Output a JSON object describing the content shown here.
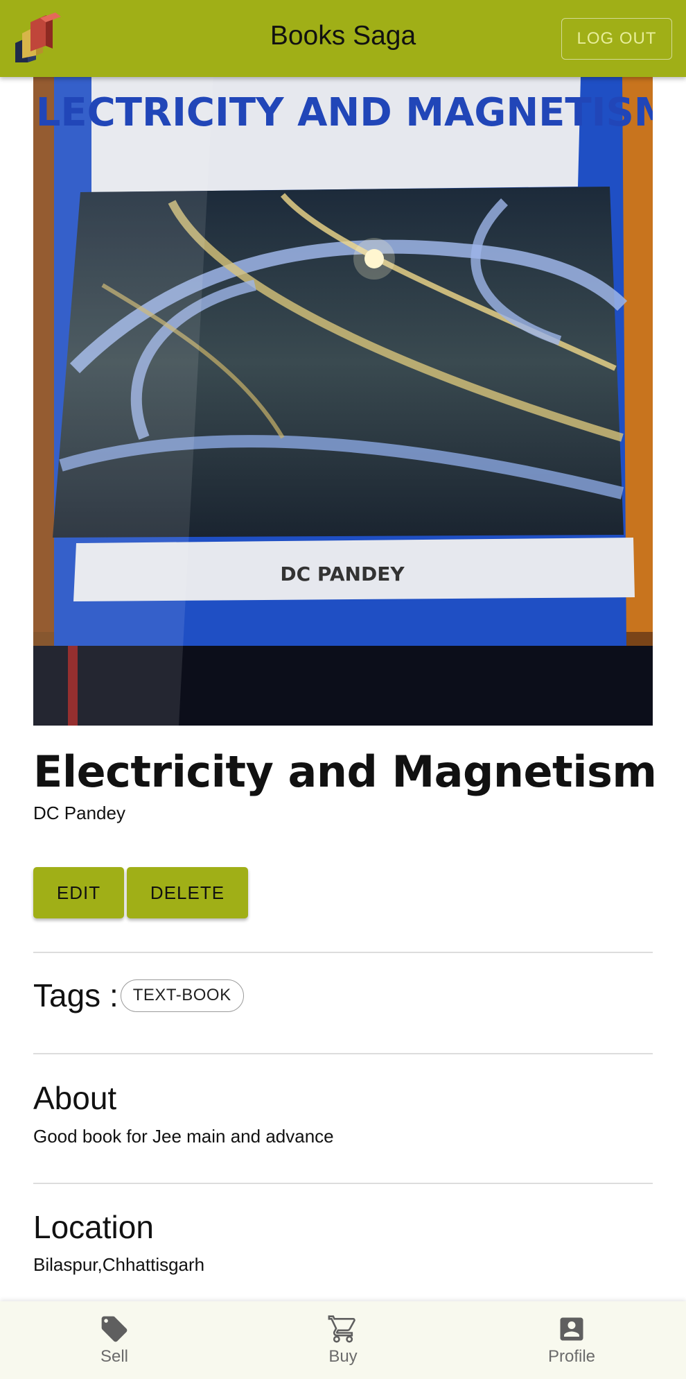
{
  "app": {
    "title": "Books Saga",
    "logout_label": "LOG OUT",
    "accent_color": "#a0af17",
    "logo_icon": "stacked-books-icon"
  },
  "book": {
    "cover_image": {
      "icon": "book-cover-photo",
      "cover_title": "ELECTRICITY AND MAGNETISM",
      "cover_author": "DC PANDEY"
    },
    "title": "Electricity and Magnetism",
    "author": "DC Pandey",
    "actions": {
      "edit_label": "EDIT",
      "delete_label": "DELETE"
    },
    "tags_label": "Tags :",
    "tags": [
      "TEXT-BOOK"
    ],
    "about_heading": "About",
    "about_text": "Good book for Jee main and advance",
    "location_heading": "Location",
    "location_text": "Bilaspur,Chhattisgarh"
  },
  "bottom_nav": {
    "items": [
      {
        "label": "Sell",
        "icon": "tag-icon"
      },
      {
        "label": "Buy",
        "icon": "cart-icon"
      },
      {
        "label": "Profile",
        "icon": "account-box-icon"
      }
    ]
  }
}
